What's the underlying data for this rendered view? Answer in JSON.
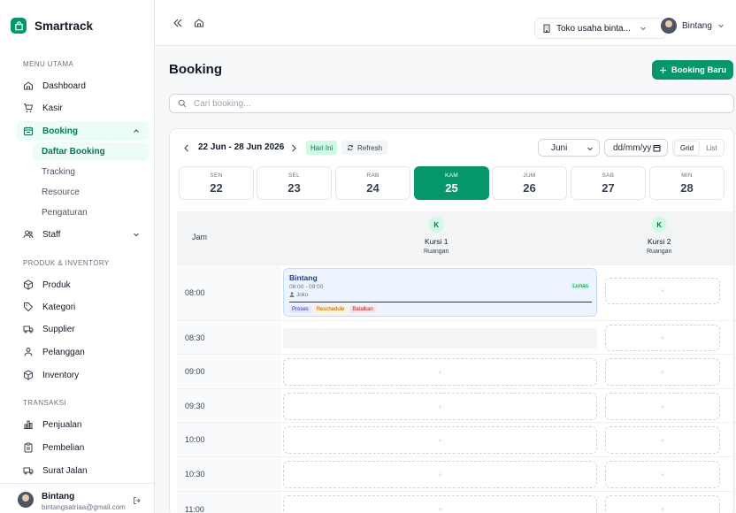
{
  "app": {
    "name": "Smartrack"
  },
  "sidebar": {
    "sections": [
      {
        "title": "MENU UTAMA"
      },
      {
        "title": "PRODUK & INVENTORY"
      },
      {
        "title": "TRANSAKSI"
      }
    ],
    "items": [
      {
        "label": "Dashboard",
        "icon": "home-icon"
      },
      {
        "label": "Kasir",
        "icon": "cart-icon"
      },
      {
        "label": "Booking",
        "icon": "calendar-icon"
      },
      {
        "label": "Staff",
        "icon": "users-icon"
      },
      {
        "label": "Produk",
        "icon": "box-icon"
      },
      {
        "label": "Kategori",
        "icon": "tag-icon"
      },
      {
        "label": "Supplier",
        "icon": "truck-icon"
      },
      {
        "label": "Pelanggan",
        "icon": "user-group-icon"
      },
      {
        "label": "Inventory",
        "icon": "box-icon"
      },
      {
        "label": "Penjualan",
        "icon": "bar-chart-icon"
      },
      {
        "label": "Pembelian",
        "icon": "clipboard-icon"
      },
      {
        "label": "Surat Jalan",
        "icon": "truck-icon"
      }
    ],
    "booking_sub": [
      "Daftar Booking",
      "Tracking",
      "Resource",
      "Pengaturan"
    ],
    "user": {
      "name": "Bintang",
      "email": "bintangsatriaa@gmail.com"
    }
  },
  "topbar": {
    "store": "Toko usaha binta...",
    "user": "Bintang"
  },
  "page": {
    "title": "Booking",
    "new_button": "Booking Baru",
    "search_placeholder": "Cari booking..."
  },
  "calendar": {
    "range": "22 Jun - 28 Jun 2026",
    "today_label": "Hari Ini",
    "refresh_label": "Refresh",
    "month": "Juni",
    "date_placeholder": "dd/mm/yy",
    "view_grid": "Grid",
    "view_list": "List",
    "days": [
      {
        "name": "SEN",
        "date": "22"
      },
      {
        "name": "SEL",
        "date": "23"
      },
      {
        "name": "RAB",
        "date": "24"
      },
      {
        "name": "KAM",
        "date": "25"
      },
      {
        "name": "JUM",
        "date": "26"
      },
      {
        "name": "SAB",
        "date": "27"
      },
      {
        "name": "MIN",
        "date": "28"
      }
    ],
    "active_day_index": 3,
    "time_header": "Jam",
    "resources": [
      {
        "initial": "K",
        "name": "Kursi 1",
        "type": "Ruangan"
      },
      {
        "initial": "K",
        "name": "Kursi 2",
        "type": "Ruangan"
      }
    ],
    "times": [
      "08:00",
      "08:30",
      "09:00",
      "09:30",
      "10:00",
      "10:30",
      "11:00"
    ],
    "slot_symbol": "+",
    "booking": {
      "customer": "Bintang",
      "time": "08:00 - 09:00",
      "status": "Lunas",
      "staff": "Joko",
      "actions": [
        "Proses",
        "Reschedule",
        "Batalkan"
      ]
    }
  },
  "colors": {
    "accent": "#059669",
    "accent_light": "#d1fae5",
    "booking_bg": "#eef4ff"
  }
}
